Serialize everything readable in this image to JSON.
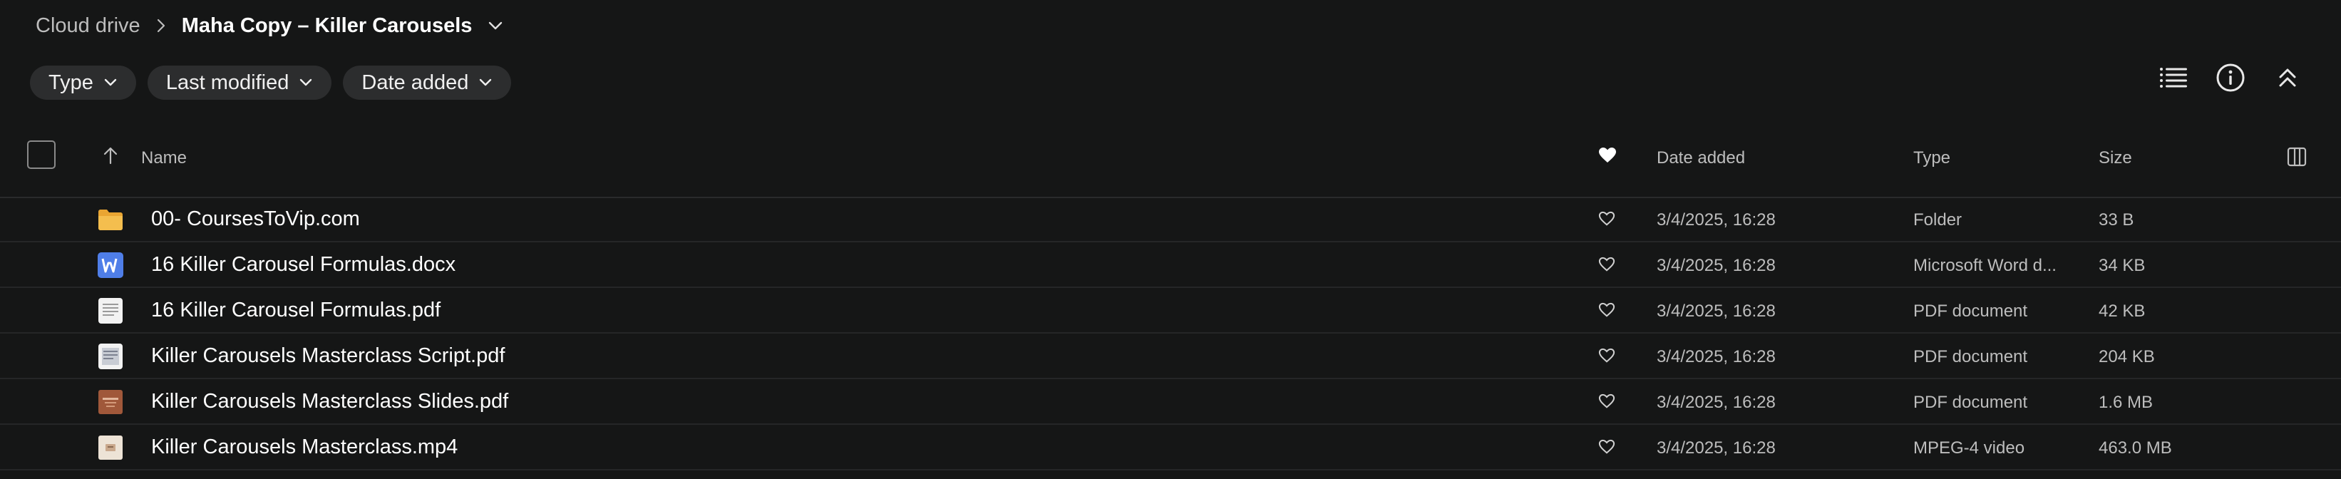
{
  "breadcrumb": {
    "root": "Cloud drive",
    "current": "Maha Copy – Killer Carousels"
  },
  "filters": [
    {
      "label": "Type"
    },
    {
      "label": "Last modified"
    },
    {
      "label": "Date added"
    }
  ],
  "toolbar": {
    "icons": [
      "list-view-icon",
      "info-icon",
      "collapse-icon"
    ]
  },
  "table": {
    "columns": {
      "name": "Name",
      "date_added": "Date added",
      "type": "Type",
      "size": "Size"
    },
    "rows": [
      {
        "icon": "folder-icon",
        "name": "00- CoursesToVip.com",
        "date": "3/4/2025, 16:28",
        "type": "Folder",
        "size": "33 B"
      },
      {
        "icon": "word-doc-icon",
        "name": "16 Killer Carousel Formulas.docx",
        "date": "3/4/2025, 16:28",
        "type": "Microsoft Word d...",
        "size": "34 KB"
      },
      {
        "icon": "pdf-icon",
        "name": "16 Killer Carousel Formulas.pdf",
        "date": "3/4/2025, 16:28",
        "type": "PDF document",
        "size": "42 KB"
      },
      {
        "icon": "pdf-icon",
        "name": "Killer Carousels Masterclass Script.pdf",
        "date": "3/4/2025, 16:28",
        "type": "PDF document",
        "size": "204 KB"
      },
      {
        "icon": "pdf-thumb-icon",
        "name": "Killer Carousels Masterclass Slides.pdf",
        "date": "3/4/2025, 16:28",
        "type": "PDF document",
        "size": "1.6 MB"
      },
      {
        "icon": "video-thumb-icon",
        "name": "Killer Carousels Masterclass.mp4",
        "date": "3/4/2025, 16:28",
        "type": "MPEG-4 video",
        "size": "463.0 MB"
      }
    ]
  },
  "colors": {
    "background": "#151616",
    "chip": "#2c2d2e",
    "folder": "#f0b43c",
    "word": "#4f7ee8"
  }
}
